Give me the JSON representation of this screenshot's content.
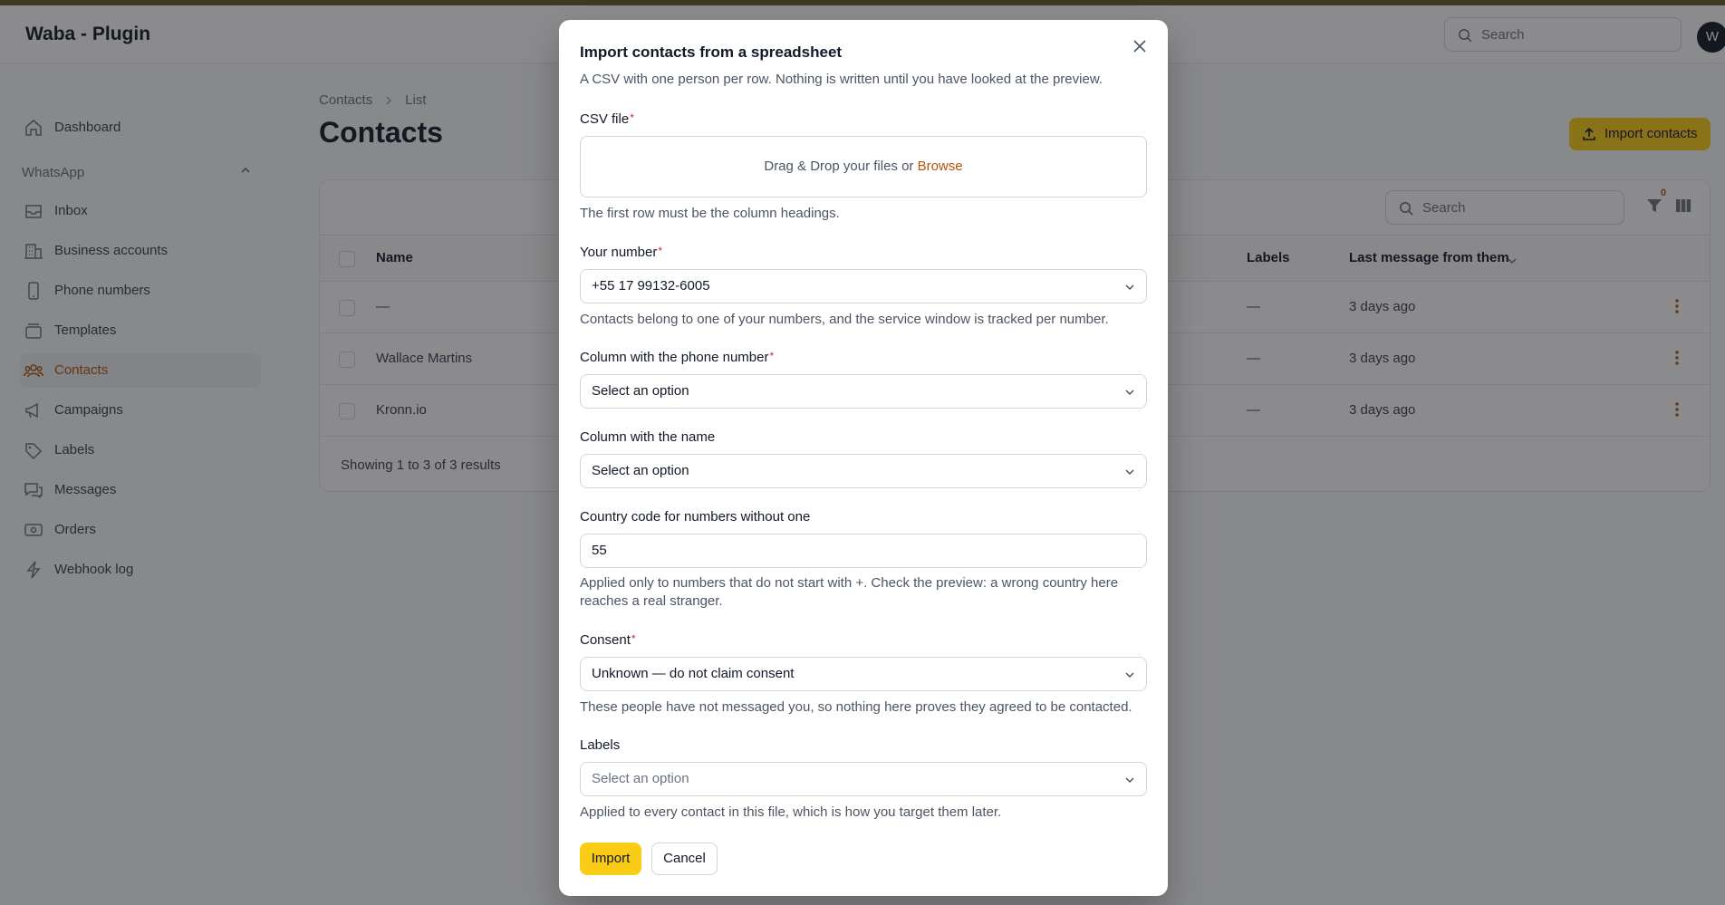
{
  "app": {
    "brand": "Waba - Plugin",
    "search_placeholder": "Search",
    "avatar_initial": "W"
  },
  "sidebar": {
    "dashboard": "Dashboard",
    "group_label": "WhatsApp",
    "items": [
      {
        "label": "Inbox",
        "icon": "inbox-icon"
      },
      {
        "label": "Business accounts",
        "icon": "building-icon"
      },
      {
        "label": "Phone numbers",
        "icon": "phone-icon"
      },
      {
        "label": "Templates",
        "icon": "template-icon"
      },
      {
        "label": "Contacts",
        "icon": "users-icon",
        "active": true
      },
      {
        "label": "Campaigns",
        "icon": "megaphone-icon"
      },
      {
        "label": "Labels",
        "icon": "tag-icon"
      },
      {
        "label": "Messages",
        "icon": "chat-icon"
      },
      {
        "label": "Orders",
        "icon": "order-icon"
      },
      {
        "label": "Webhook log",
        "icon": "bolt-icon"
      }
    ]
  },
  "page": {
    "breadcrumb": [
      "Contacts",
      "List"
    ],
    "title": "Contacts",
    "import_button": "Import contacts",
    "table_search_placeholder": "Search",
    "filter_count": "0",
    "columns": {
      "name": "Name",
      "labels": "Labels",
      "last_message": "Last message from them"
    },
    "rows": [
      {
        "name": "—",
        "labels": "—",
        "last": "3 days ago"
      },
      {
        "name": "Wallace Martins",
        "labels": "—",
        "last": "3 days ago"
      },
      {
        "name": "Kronn.io",
        "labels": "—",
        "last": "3 days ago"
      }
    ],
    "footer": "Showing 1 to 3 of 3 results"
  },
  "modal": {
    "title": "Import contacts from a spreadsheet",
    "description": "A CSV with one person per row. Nothing is written until you have looked at the preview.",
    "csv_label": "CSV file",
    "dropzone_text": "Drag & Drop your files or",
    "dropzone_browse": "Browse",
    "csv_hint": "The first row must be the column headings.",
    "number_label": "Your number",
    "number_value": "+55 17 99132-6005",
    "number_hint": "Contacts belong to one of your numbers, and the service window is tracked per number.",
    "phone_col_label": "Column with the phone number",
    "phone_col_value": "Select an option",
    "name_col_label": "Column with the name",
    "name_col_value": "Select an option",
    "country_label": "Country code for numbers without one",
    "country_value": "55",
    "country_hint": "Applied only to numbers that do not start with +. Check the preview: a wrong country here reaches a real stranger.",
    "consent_label": "Consent",
    "consent_value": "Unknown — do not claim consent",
    "consent_hint": "These people have not messaged you, so nothing here proves they agreed to be contacted.",
    "labels_label": "Labels",
    "labels_placeholder": "Select an option",
    "labels_hint": "Applied to every contact in this file, which is how you target them later.",
    "import_button": "Import",
    "cancel_button": "Cancel",
    "required_mark": "*"
  },
  "colors": {
    "accent": "#facc15",
    "active_text": "#b45309",
    "required": "#dc2626"
  }
}
